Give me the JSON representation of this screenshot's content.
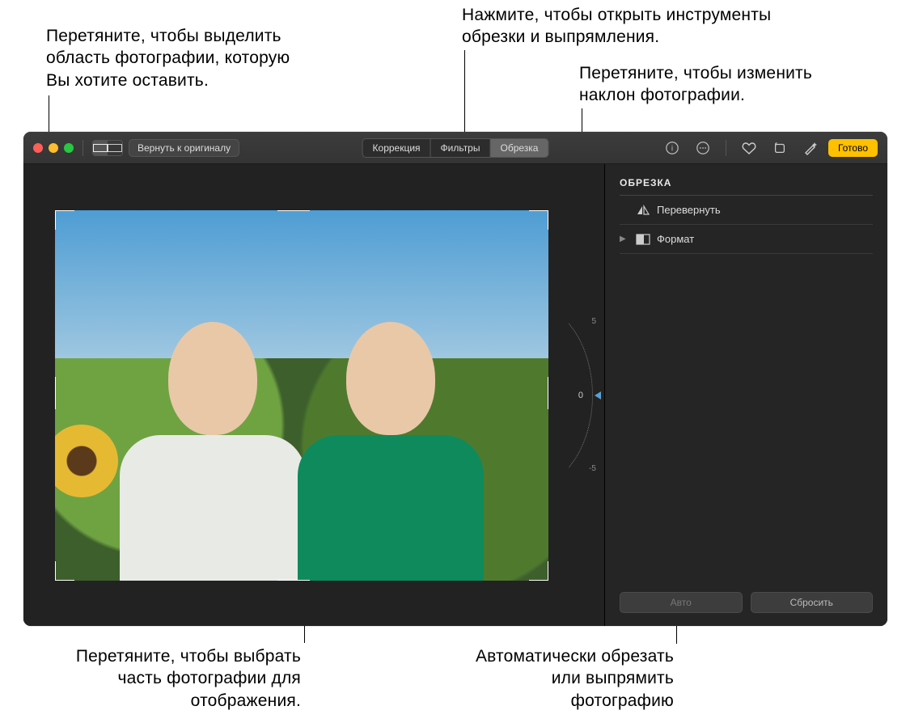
{
  "callouts": {
    "top_left": "Перетяните, чтобы выделить область фотографии, которую Вы хотите оставить.",
    "top_right_a": "Нажмите, чтобы открыть инструменты обрезки и выпрямления.",
    "top_right_b": "Перетяните, чтобы изменить наклон фотографии.",
    "bottom_left": "Перетяните, чтобы выбрать часть фотографии для отображения.",
    "bottom_right": "Автоматически обрезать или выпрямить фотографию"
  },
  "toolbar": {
    "revert": "Вернуть к оригиналу",
    "tabs": {
      "adjust": "Коррекция",
      "filters": "Фильтры",
      "crop": "Обрезка"
    },
    "done": "Готово"
  },
  "panel": {
    "title": "ОБРЕЗКА",
    "flip": "Перевернуть",
    "aspect": "Формат",
    "auto": "Авто",
    "reset": "Сбросить"
  },
  "dial": {
    "value": "0",
    "tick_up": "5",
    "tick_down": "-5"
  }
}
